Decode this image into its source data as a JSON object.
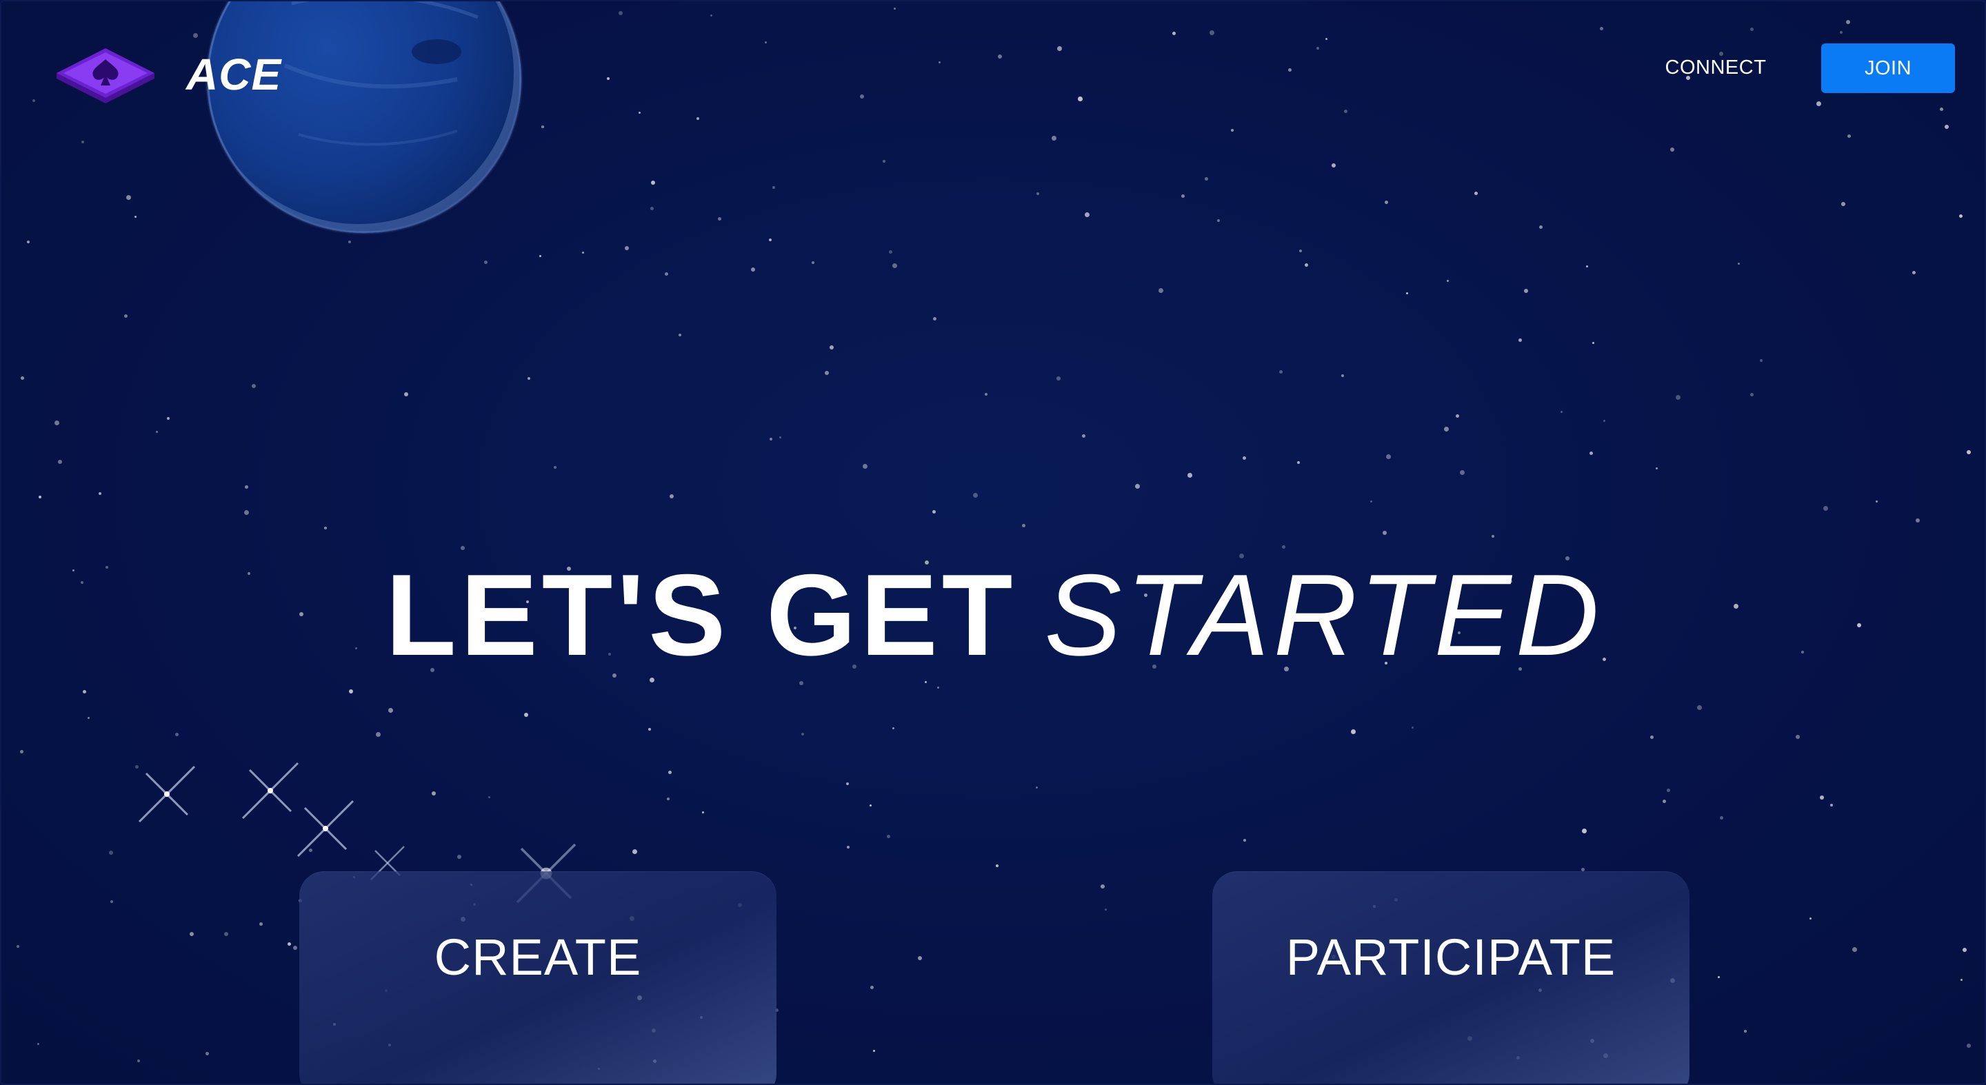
{
  "header": {
    "brand": "ACE",
    "logo_icon": "spade-diamond-logo-icon",
    "nav": {
      "connect_label": "CONNECT",
      "join_label": "JOIN"
    }
  },
  "hero": {
    "title_strong": "LET'S GET",
    "title_emphasis": "STARTED"
  },
  "cards": {
    "create_label": "CREATE",
    "participate_label": "PARTICIPATE"
  },
  "colors": {
    "background": "#061349",
    "accent": "#0a7af5",
    "logo": "#7b2fe0",
    "text": "#ffffff"
  }
}
